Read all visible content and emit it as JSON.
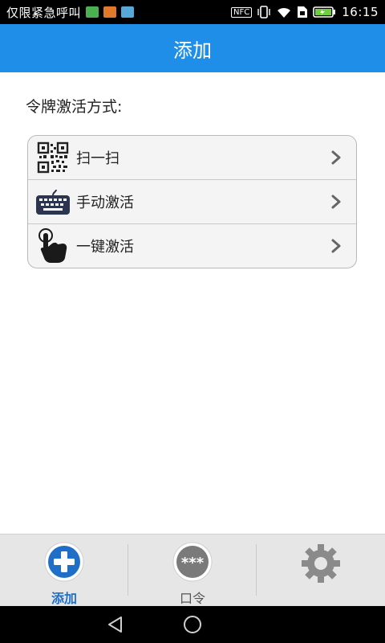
{
  "status_bar": {
    "carrier_text": "仅限紧急呼叫",
    "nfc_text": "NFC",
    "time": "16:15"
  },
  "title_bar": {
    "title": "添加"
  },
  "main": {
    "section_label": "令牌激活方式:",
    "items": [
      {
        "label": "扫一扫",
        "icon": "qr-code-icon"
      },
      {
        "label": "手动激活",
        "icon": "keyboard-icon"
      },
      {
        "label": "一键激活",
        "icon": "tap-hand-icon"
      }
    ]
  },
  "bottom_nav": {
    "tabs": [
      {
        "label": "添加",
        "icon": "add-circle-icon",
        "active": true
      },
      {
        "label": "口令",
        "icon": "password-dots-icon",
        "active": false
      },
      {
        "label": "",
        "icon": "gear-icon",
        "active": false
      }
    ]
  },
  "colors": {
    "accent": "#1f8ee8",
    "active_tab": "#1f6fc9",
    "status_bar": "#000000"
  }
}
